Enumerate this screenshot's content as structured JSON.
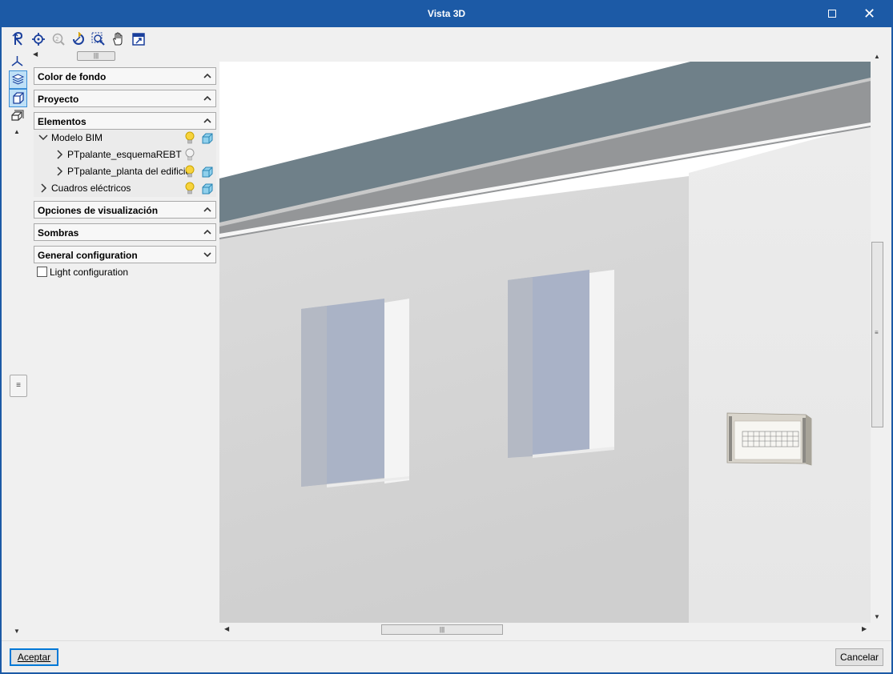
{
  "window": {
    "title": "Vista 3D"
  },
  "toolbar": {
    "tools": [
      {
        "icon": "orbit-icon"
      },
      {
        "icon": "zoom-all-icon"
      },
      {
        "icon": "zoom-previous-icon"
      },
      {
        "icon": "rotate-icon"
      },
      {
        "icon": "zoom-window-icon"
      },
      {
        "icon": "pan-hand-icon"
      },
      {
        "icon": "export-view-icon"
      }
    ]
  },
  "left_strip": {
    "buttons": [
      {
        "icon": "axes-icon"
      },
      {
        "icon": "layers-icon",
        "active": true
      },
      {
        "icon": "box-view-icon",
        "active": true
      },
      {
        "icon": "shapes-icon"
      }
    ]
  },
  "panel": {
    "sections": {
      "background_color": {
        "label": "Color de fondo",
        "expanded": true
      },
      "project": {
        "label": "Proyecto",
        "expanded": true
      },
      "elements": {
        "label": "Elementos",
        "expanded": true
      },
      "display_options": {
        "label": "Opciones de visualización",
        "expanded": true
      },
      "shadows": {
        "label": "Sombras",
        "expanded": true
      },
      "general_configuration": {
        "label": "General configuration",
        "expanded": false
      }
    },
    "tree": [
      {
        "label": "Modelo BIM",
        "expanded": true,
        "level": 0,
        "bulb_on": true,
        "cube": true
      },
      {
        "label": "PTpalante_esquemaREBT",
        "expanded": false,
        "level": 1,
        "bulb_on": false,
        "cube": false
      },
      {
        "label": "PTpalante_planta del edificio",
        "expanded": false,
        "level": 1,
        "bulb_on": true,
        "cube": true
      },
      {
        "label": "Cuadros eléctricos",
        "expanded": false,
        "level": 0,
        "bulb_on": true,
        "cube": true
      }
    ],
    "light_configuration": {
      "label": "Light configuration",
      "checked": false
    }
  },
  "footer": {
    "accept_label": "Aceptar",
    "cancel_label": "Cancelar"
  },
  "colors": {
    "title_bar": "#1c5aa6",
    "roof": "#6f8089",
    "wall": "#d9d9d9",
    "window_glass": "#a9b4c8",
    "accent": "#0078d7"
  }
}
